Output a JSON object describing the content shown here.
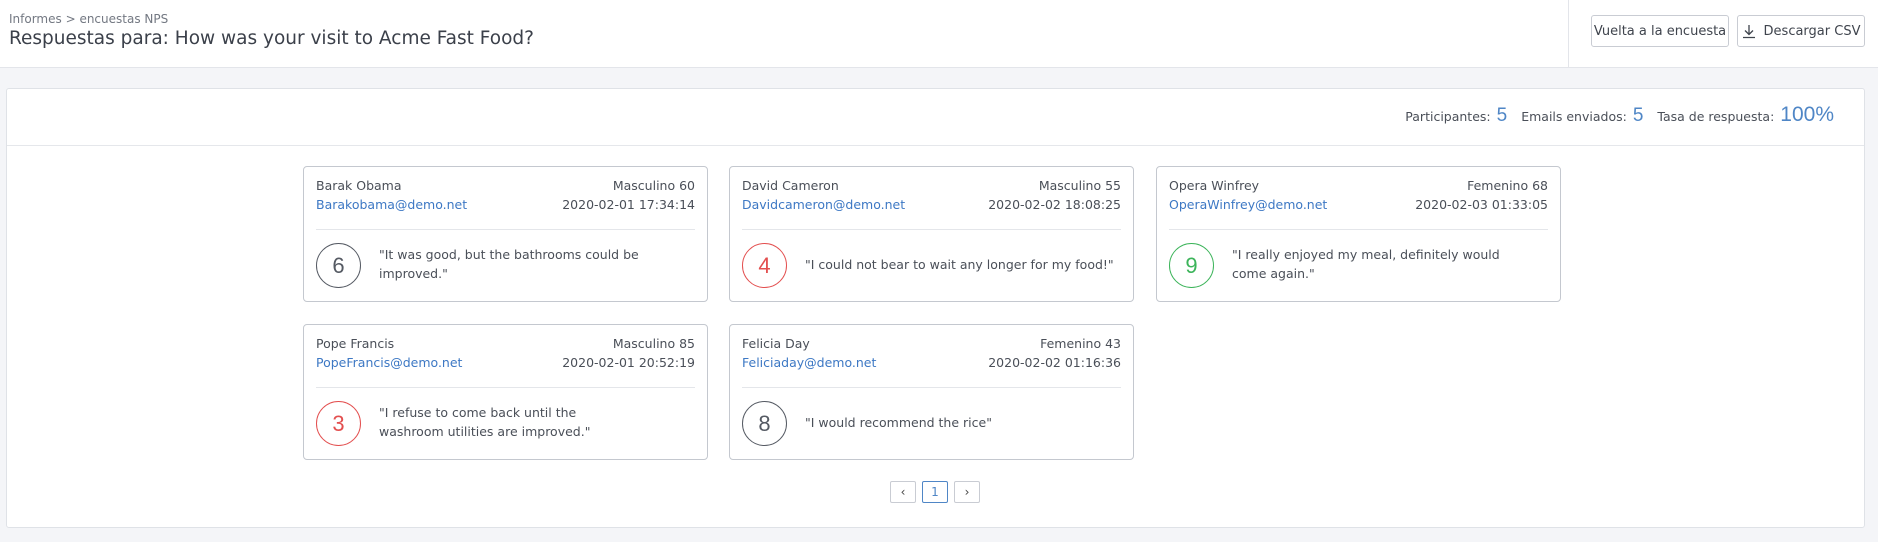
{
  "header": {
    "breadcrumb": "Informes > encuestas NPS",
    "title": "Respuestas para: How was your visit to Acme Fast Food?",
    "back_button": "Vuelta a la encuesta",
    "csv_button": "Descargar CSV"
  },
  "stats": {
    "participants_label": "Participantes:",
    "participants_value": "5",
    "emails_label": "Emails enviados:",
    "emails_value": "5",
    "rate_label": "Tasa de respuesta:",
    "rate_value": "100%"
  },
  "responses": [
    {
      "name": "Barak Obama",
      "meta": "Masculino 60",
      "email": "Barakobama@demo.net",
      "date": "2020-02-01 17:34:14",
      "score": "6",
      "category": "neutral",
      "comment": "\"It was good, but the bathrooms could be improved.\""
    },
    {
      "name": "David Cameron",
      "meta": "Masculino 55",
      "email": "Davidcameron@demo.net",
      "date": "2020-02-02 18:08:25",
      "score": "4",
      "category": "detractor",
      "comment": "\"I could not bear to wait any longer for my food!\""
    },
    {
      "name": "Opera Winfrey",
      "meta": "Femenino 68",
      "email": "OperaWinfrey@demo.net",
      "date": "2020-02-03 01:33:05",
      "score": "9",
      "category": "promoter",
      "comment": "\"I really enjoyed my meal, definitely would come again.\""
    },
    {
      "name": "Pope Francis",
      "meta": "Masculino 85",
      "email": "PopeFrancis@demo.net",
      "date": "2020-02-01 20:52:19",
      "score": "3",
      "category": "detractor",
      "comment": "\"I refuse to come back until the washroom utilities are improved.\""
    },
    {
      "name": "Felicia Day",
      "meta": "Femenino 43",
      "email": "Feliciaday@demo.net",
      "date": "2020-02-02 01:16:36",
      "score": "8",
      "category": "neutral",
      "comment": "\"I would recommend the rice\""
    }
  ],
  "pagination": {
    "prev": "‹",
    "current": "1",
    "next": "›"
  },
  "colors": {
    "accent": "#4f86c6",
    "detractor": "#e34f4f",
    "promoter": "#3cb45a",
    "neutral": "#555a63"
  }
}
